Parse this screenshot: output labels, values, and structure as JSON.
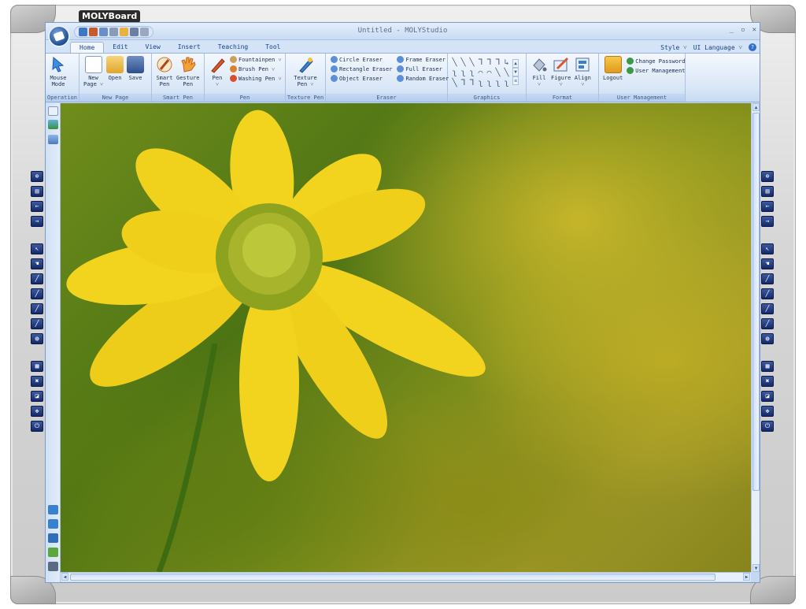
{
  "board": {
    "brand": "MOLYBoard"
  },
  "window": {
    "title": "Untitled - MOLYStudio",
    "controls": [
      "_",
      "▫",
      "✕"
    ]
  },
  "tabs": [
    "Home",
    "Edit",
    "View",
    "Insert",
    "Teaching",
    "Tool"
  ],
  "tab_right": {
    "style": "Style ˅",
    "language": "UI Language ˅",
    "help": "?"
  },
  "ribbon": {
    "operation": {
      "label": "Operation",
      "mouse_mode": "Mouse\nMode"
    },
    "new_page": {
      "label": "New Page",
      "new": "New\nPage ˅",
      "open": "Open",
      "save": "Save"
    },
    "smart_pen": {
      "label": "Smart Pen",
      "smart": "Smart\nPen",
      "gesture": "Gesture\nPen"
    },
    "pen": {
      "label": "Pen",
      "pen": "Pen\n˅",
      "fountainpen": "Fountainpen ˅",
      "brush": "Brush Pen ˅",
      "washing": "Washing Pen ˅"
    },
    "texture_pen": {
      "label": "Texture Pen",
      "texture": "Texture\nPen ˅"
    },
    "eraser": {
      "label": "Eraser",
      "circle": "Circle Eraser",
      "rectangle": "Rectangle Eraser",
      "object": "Object Eraser",
      "frame": "Frame Eraser",
      "full": "Full Eraser",
      "random": "Random Eraser"
    },
    "graphics": {
      "label": "Graphics",
      "shapes": [
        "╲",
        "╲",
        "╲",
        "⅂",
        "⅂",
        "⅂",
        "↳",
        "ʅ",
        "ʅ",
        "ʅ",
        "⌒",
        "⌒",
        "╲",
        "╲",
        "╲",
        "⅂",
        "⅂",
        "ʅ",
        "ʅ",
        "ʅ",
        "ʅ"
      ],
      "scroll": [
        "▲",
        "▼",
        "≡"
      ]
    },
    "format": {
      "label": "Format",
      "fill": "Fill\n˅",
      "figure": "Figure\n˅",
      "align": "Align\n˅"
    },
    "user_management": {
      "label": "User Management",
      "logout": "Logout",
      "change_password": "Change Password",
      "user_management": "User Management"
    }
  },
  "scrollbars": {
    "up": "▲",
    "down": "▼",
    "left": "◀",
    "right": "▶"
  },
  "side_toolbar": [
    "⊕",
    "▤",
    "←",
    "→",
    "↖",
    "☚",
    "╱",
    "╱",
    "╱",
    "╱",
    "◍",
    "▦",
    "✖",
    "◪",
    "✥",
    "⏻"
  ],
  "colors": {
    "ribbon_bg": "#dae7f7",
    "accent": "#15428b",
    "petal": "#f2d41f",
    "petal_shade": "#dcb30e",
    "center": "#8da21f"
  }
}
